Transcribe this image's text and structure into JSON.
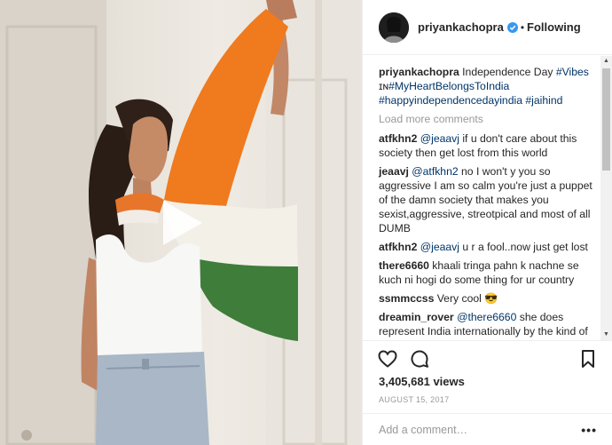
{
  "header": {
    "username": "priyankachopra",
    "separator": "•",
    "follow_label": "Following"
  },
  "caption": {
    "username": "priyankachopra",
    "text": " Independence Day ",
    "tag1": "#Vibes",
    "styled": " ɪɴ",
    "tag2": "#MyHeartBelongsToIndia",
    "tag3": "#happyindependencedayindia",
    "tag4": "#jaihind"
  },
  "load_more_label": "Load more comments",
  "comments": [
    {
      "user": "atfkhn2",
      "mention": "@jeaavj",
      "text": " if u don't care about this society then get lost from this world"
    },
    {
      "user": "jeaavj",
      "mention": "@atfkhn2",
      "text": " no I won't y you so aggressive I am so calm you're just a puppet of the damn society that makes you sexist,aggressive, streotpical and most of all DUMB"
    },
    {
      "user": "atfkhn2",
      "mention": "@jeaavj",
      "text": " u r a fool..now just get lost"
    },
    {
      "user": "there6660",
      "mention": "",
      "text": " khaali tringa pahn k nachne se kuch ni hogi do some thing for ur country"
    },
    {
      "user": "ssmmccss",
      "mention": "",
      "text": " Very cool 😎"
    },
    {
      "user": "dreamin_rover",
      "mention": "@there6660",
      "text": " she does represent India internationally by the kind of brilliant work she already is doing, aur"
    }
  ],
  "scrollbar": {
    "up": "▲",
    "down": "▼"
  },
  "stats": {
    "views": "3,405,681 views",
    "date": "AUGUST 15, 2017"
  },
  "add_comment": {
    "placeholder": "Add a comment…",
    "more": "•••"
  },
  "icons": {
    "like": "heart-icon",
    "comment": "comment-icon",
    "save": "bookmark-icon",
    "verified": "verified-badge-icon",
    "play": "play-icon"
  },
  "colors": {
    "saffron": "#f07a1e",
    "green": "#3f7d3a",
    "link": "#003569",
    "verified": "#3897f0"
  }
}
